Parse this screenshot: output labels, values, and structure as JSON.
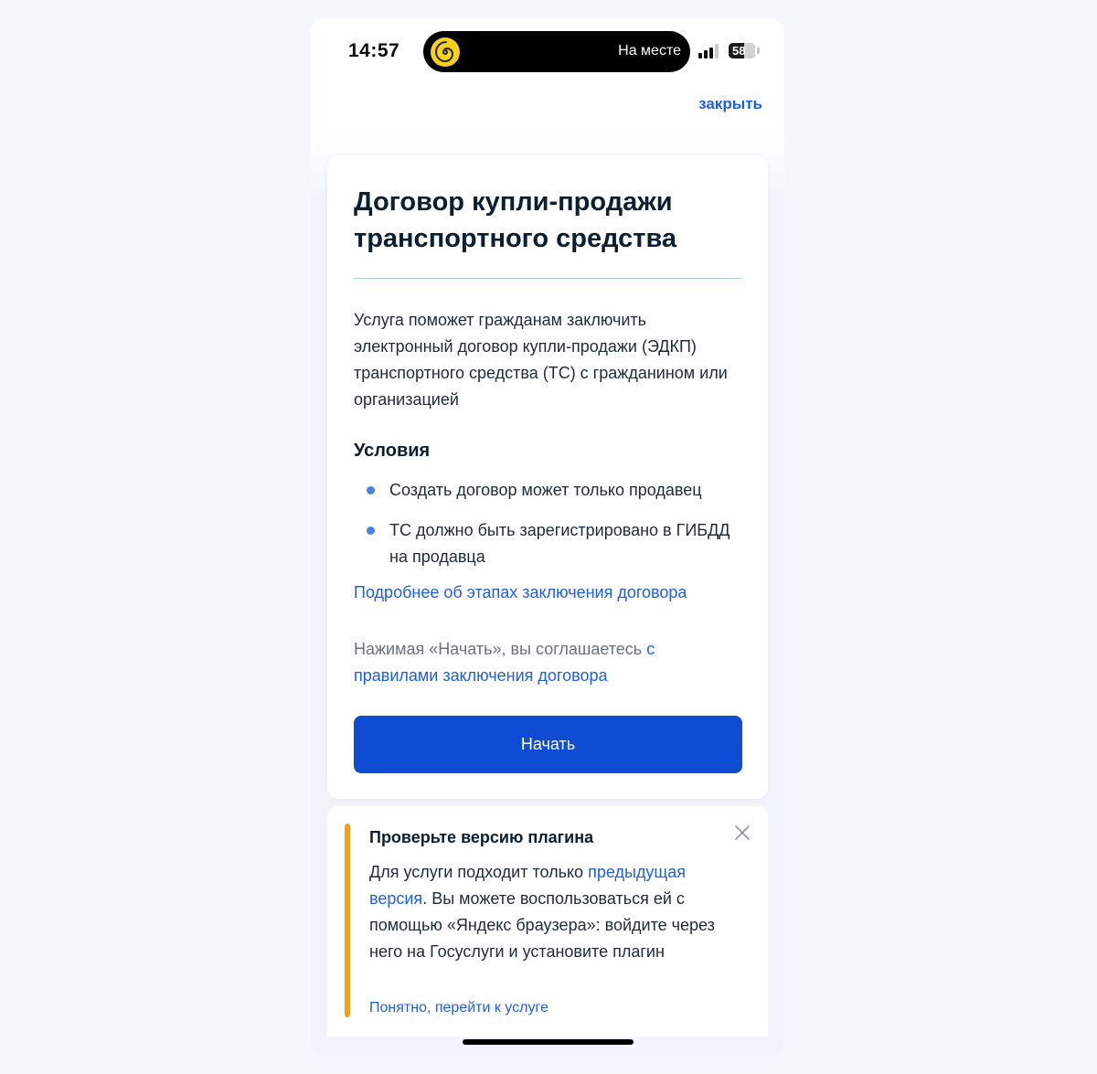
{
  "status_bar": {
    "time": "14:57",
    "island_text": "На месте",
    "island_icon": "spiral-logo-icon",
    "signal_bars": 3,
    "signal_bars_total": 4,
    "battery_percent": "58",
    "battery_level": 0.58
  },
  "header": {
    "close_label": "закрыть"
  },
  "card": {
    "title": "Договор купли-продажи транспортного средства",
    "description": "Услуга поможет гражданам заключить электронный договор купли-продажи (ЭДКП) транспортного средства (ТС) с гражданином или организацией",
    "conditions_title": "Условия",
    "conditions": [
      "Создать договор может только продавец",
      "ТС должно быть зарегистрировано в ГИБДД на продавца"
    ],
    "more_link": "Подробнее об этапах заключения договора",
    "agree_text": "Нажимая «Начать», вы соглашаетесь ",
    "agree_link": "с правилами заключения договора",
    "start_button": "Начать"
  },
  "alert": {
    "title": "Проверьте версию плагина",
    "body_before": "Для услуги подходит только ",
    "body_link": "предыдущая версия",
    "body_after": ". Вы можете воспользоваться ей с помощью «Яндекс браузера»: войдите через него на Госуслуги и установите плагин",
    "action_link": "Понятно, перейти к услуге",
    "close_icon": "close-icon"
  },
  "colors": {
    "accent": "#0d4cd3",
    "link": "#1d5deb",
    "alert_bar": "#f59d1c",
    "bullet": "#4a7fe6"
  }
}
